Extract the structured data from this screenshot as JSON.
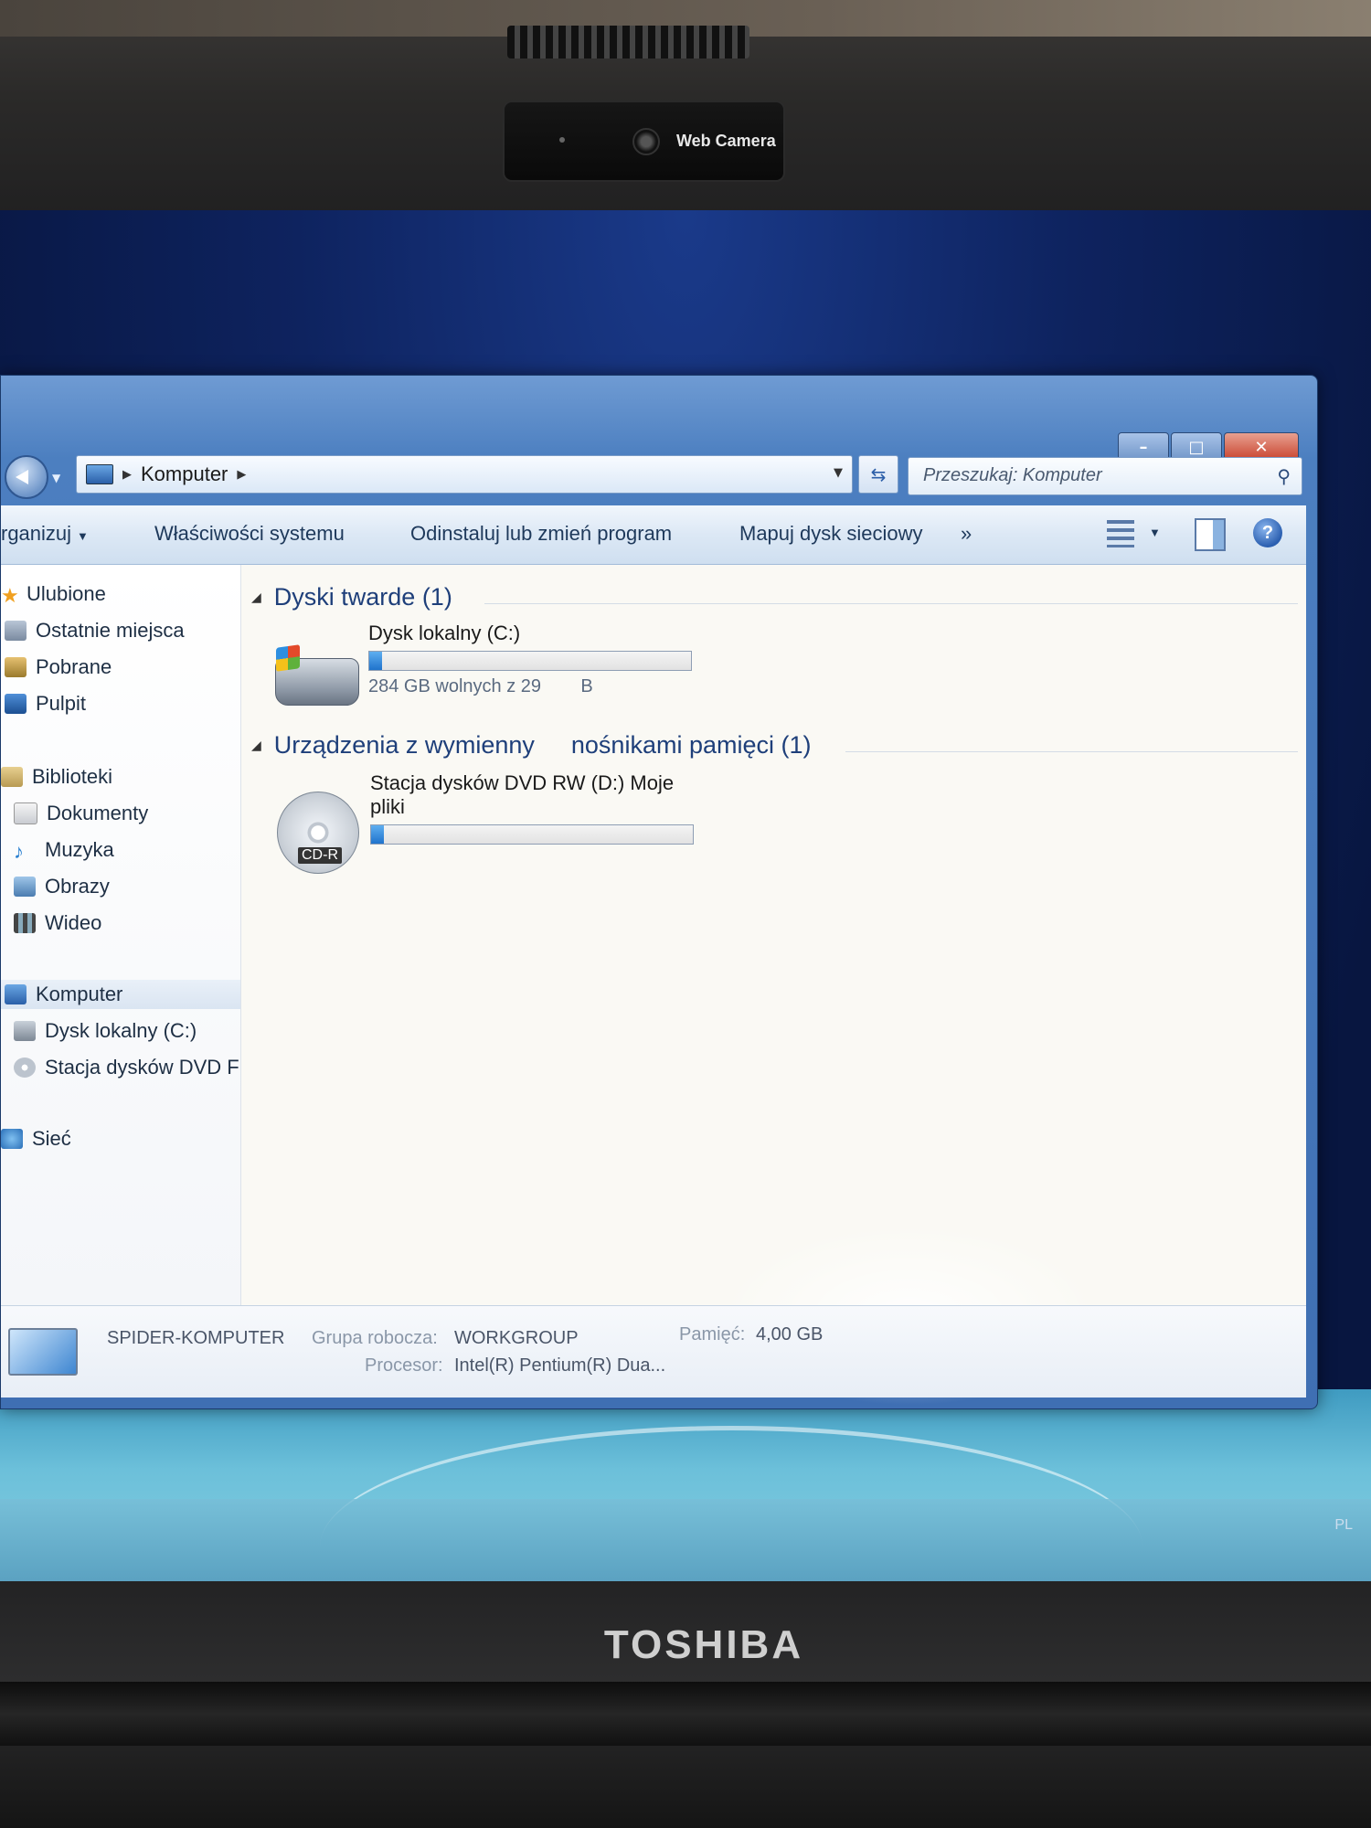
{
  "hardware": {
    "webcam_label": "Web Camera",
    "brand": "TOSHIBA"
  },
  "window": {
    "controls": {
      "minimize": "–",
      "maximize": "□",
      "close": "✕"
    },
    "address": {
      "segment": "Komputer"
    },
    "search": {
      "placeholder": "Przeszukaj: Komputer"
    },
    "toolbar": {
      "organize": "rganizuj",
      "system_properties": "Właściwości systemu",
      "uninstall": "Odinstaluj lub zmień program",
      "map_drive": "Mapuj dysk sieciowy",
      "more": "»"
    }
  },
  "sidebar": {
    "favorites": {
      "label": "Ulubione",
      "items": [
        "Ostatnie miejsca",
        "Pobrane",
        "Pulpit"
      ]
    },
    "libraries": {
      "label": "Biblioteki",
      "items": [
        "Dokumenty",
        "Muzyka",
        "Obrazy",
        "Wideo"
      ]
    },
    "computer": {
      "label": "Komputer",
      "items": [
        "Dysk lokalny (C:)",
        "Stacja dysków DVD F"
      ]
    },
    "network": {
      "label": "Sieć"
    }
  },
  "groups": {
    "hard_disks": {
      "title": "Dyski twarde (1)",
      "drive": {
        "name": "Dysk lokalny (C:)",
        "free_text": "284 GB wolnych z 29",
        "free_text_tail": "B",
        "used_fraction": 0.04
      }
    },
    "removable": {
      "title_part1": "Urządzenia z wymienny",
      "title_part2": "nośnikami pamięci (1)",
      "drive": {
        "name_line1": "Stacja dysków DVD RW (D:) Moje",
        "name_line2": "pliki",
        "icon_label": "CD-R",
        "used_fraction": 0.04
      }
    }
  },
  "details": {
    "computer_name": "SPIDER-KOMPUTER",
    "workgroup_label": "Grupa robocza:",
    "workgroup_value": "WORKGROUP",
    "memory_label": "Pamięć:",
    "memory_value": "4,00 GB",
    "processor_label": "Procesor:",
    "processor_value": "Intel(R) Pentium(R) Dua..."
  },
  "tray": {
    "lang": "PL"
  },
  "colors": {
    "accent": "#1f73cc",
    "window_frame": "#4c7fc0",
    "toolbar_text": "#1e395b"
  }
}
